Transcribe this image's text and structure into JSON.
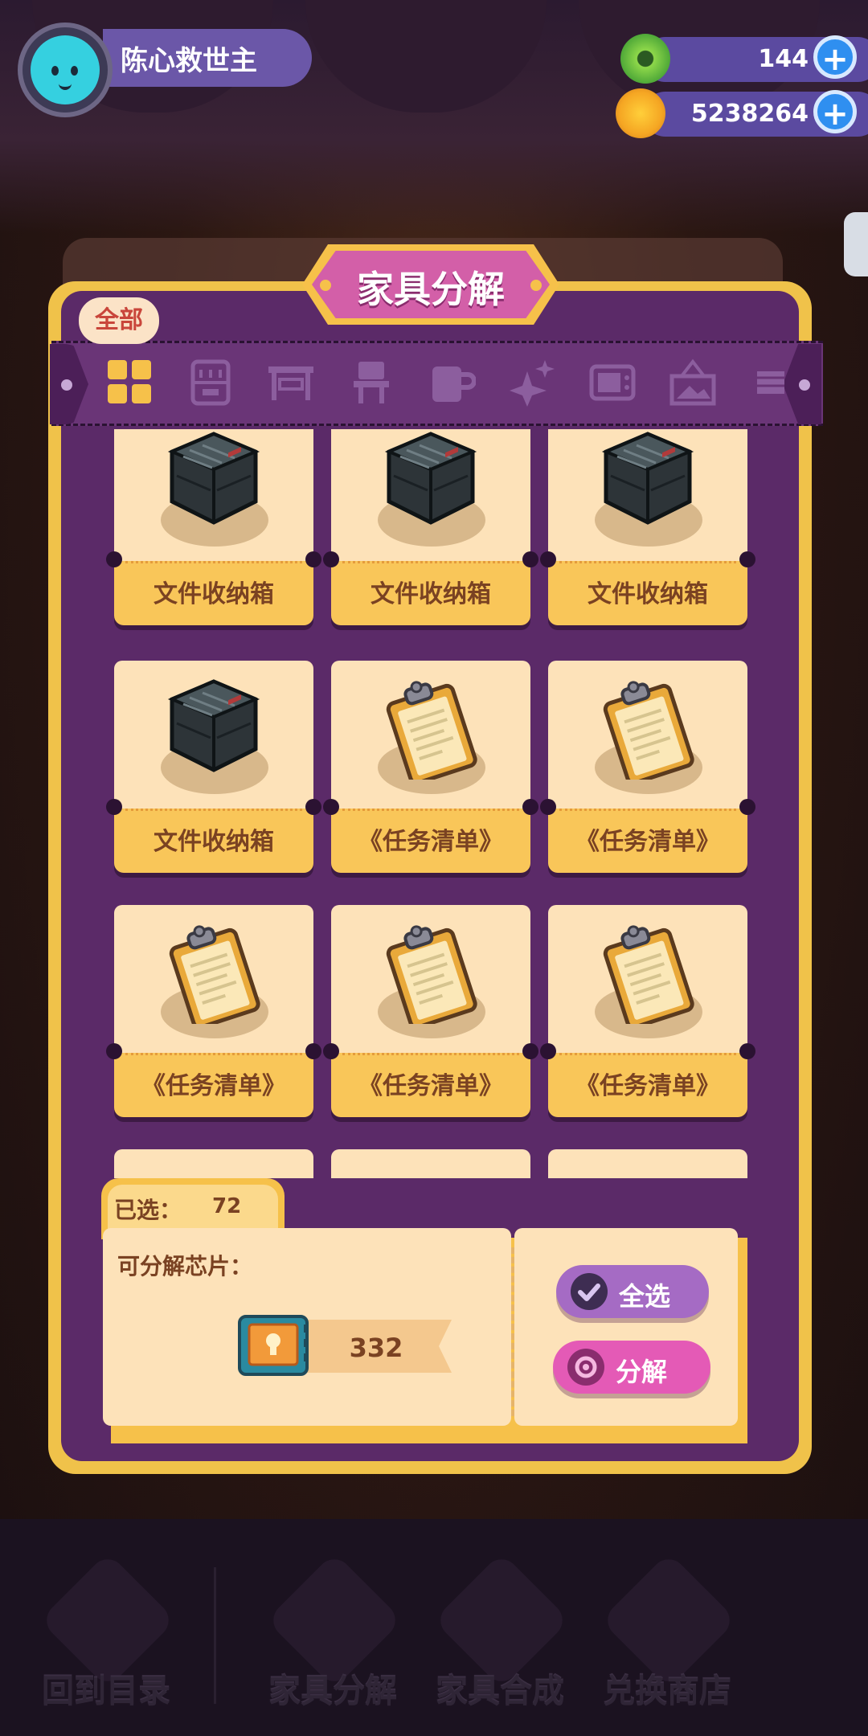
{
  "header": {
    "player_name": "陈心救世主",
    "currencies": [
      {
        "icon": "green-donut-icon",
        "value": "144"
      },
      {
        "icon": "gold-planet-icon",
        "value": "5238264"
      }
    ]
  },
  "panel": {
    "title": "家具分解",
    "filter_label": "全部",
    "tabs": [
      "grid-all-icon",
      "cabinet-icon",
      "table-icon",
      "chair-icon",
      "cup-icon",
      "sparkle-icon",
      "tv-icon",
      "frame-icon",
      "partial-icon"
    ]
  },
  "items": [
    {
      "name": "文件收纳箱",
      "type": "box"
    },
    {
      "name": "文件收纳箱",
      "type": "box"
    },
    {
      "name": "文件收纳箱",
      "type": "box"
    },
    {
      "name": "文件收纳箱",
      "type": "box"
    },
    {
      "name": "《任务清单》",
      "type": "clipboard"
    },
    {
      "name": "《任务清单》",
      "type": "clipboard"
    },
    {
      "name": "《任务清单》",
      "type": "clipboard"
    },
    {
      "name": "《任务清单》",
      "type": "clipboard"
    },
    {
      "name": "《任务清单》",
      "type": "clipboard"
    },
    {
      "name": "",
      "type": "partial"
    },
    {
      "name": "",
      "type": "partial"
    },
    {
      "name": "",
      "type": "partial"
    }
  ],
  "selection": {
    "selected_label": "已选：",
    "selected_count": "72",
    "chips_label": "可分解芯片：",
    "chips_count": "332",
    "select_all_label": "全选",
    "decompose_label": "分解"
  },
  "nav": [
    {
      "label": "回到目录",
      "icon": "back-catalog-icon"
    },
    {
      "label": "家具分解",
      "icon": "puzzle-icon"
    },
    {
      "label": "家具合成",
      "icon": "hammer-icon"
    },
    {
      "label": "兑换商店",
      "icon": "gift-icon"
    }
  ],
  "colors": {
    "panel_purple": "#5b2a68",
    "gold": "#f0c24a",
    "title_pink": "#d35fa8",
    "button_purple": "#a56bc4",
    "button_pink": "#e45ab6"
  }
}
